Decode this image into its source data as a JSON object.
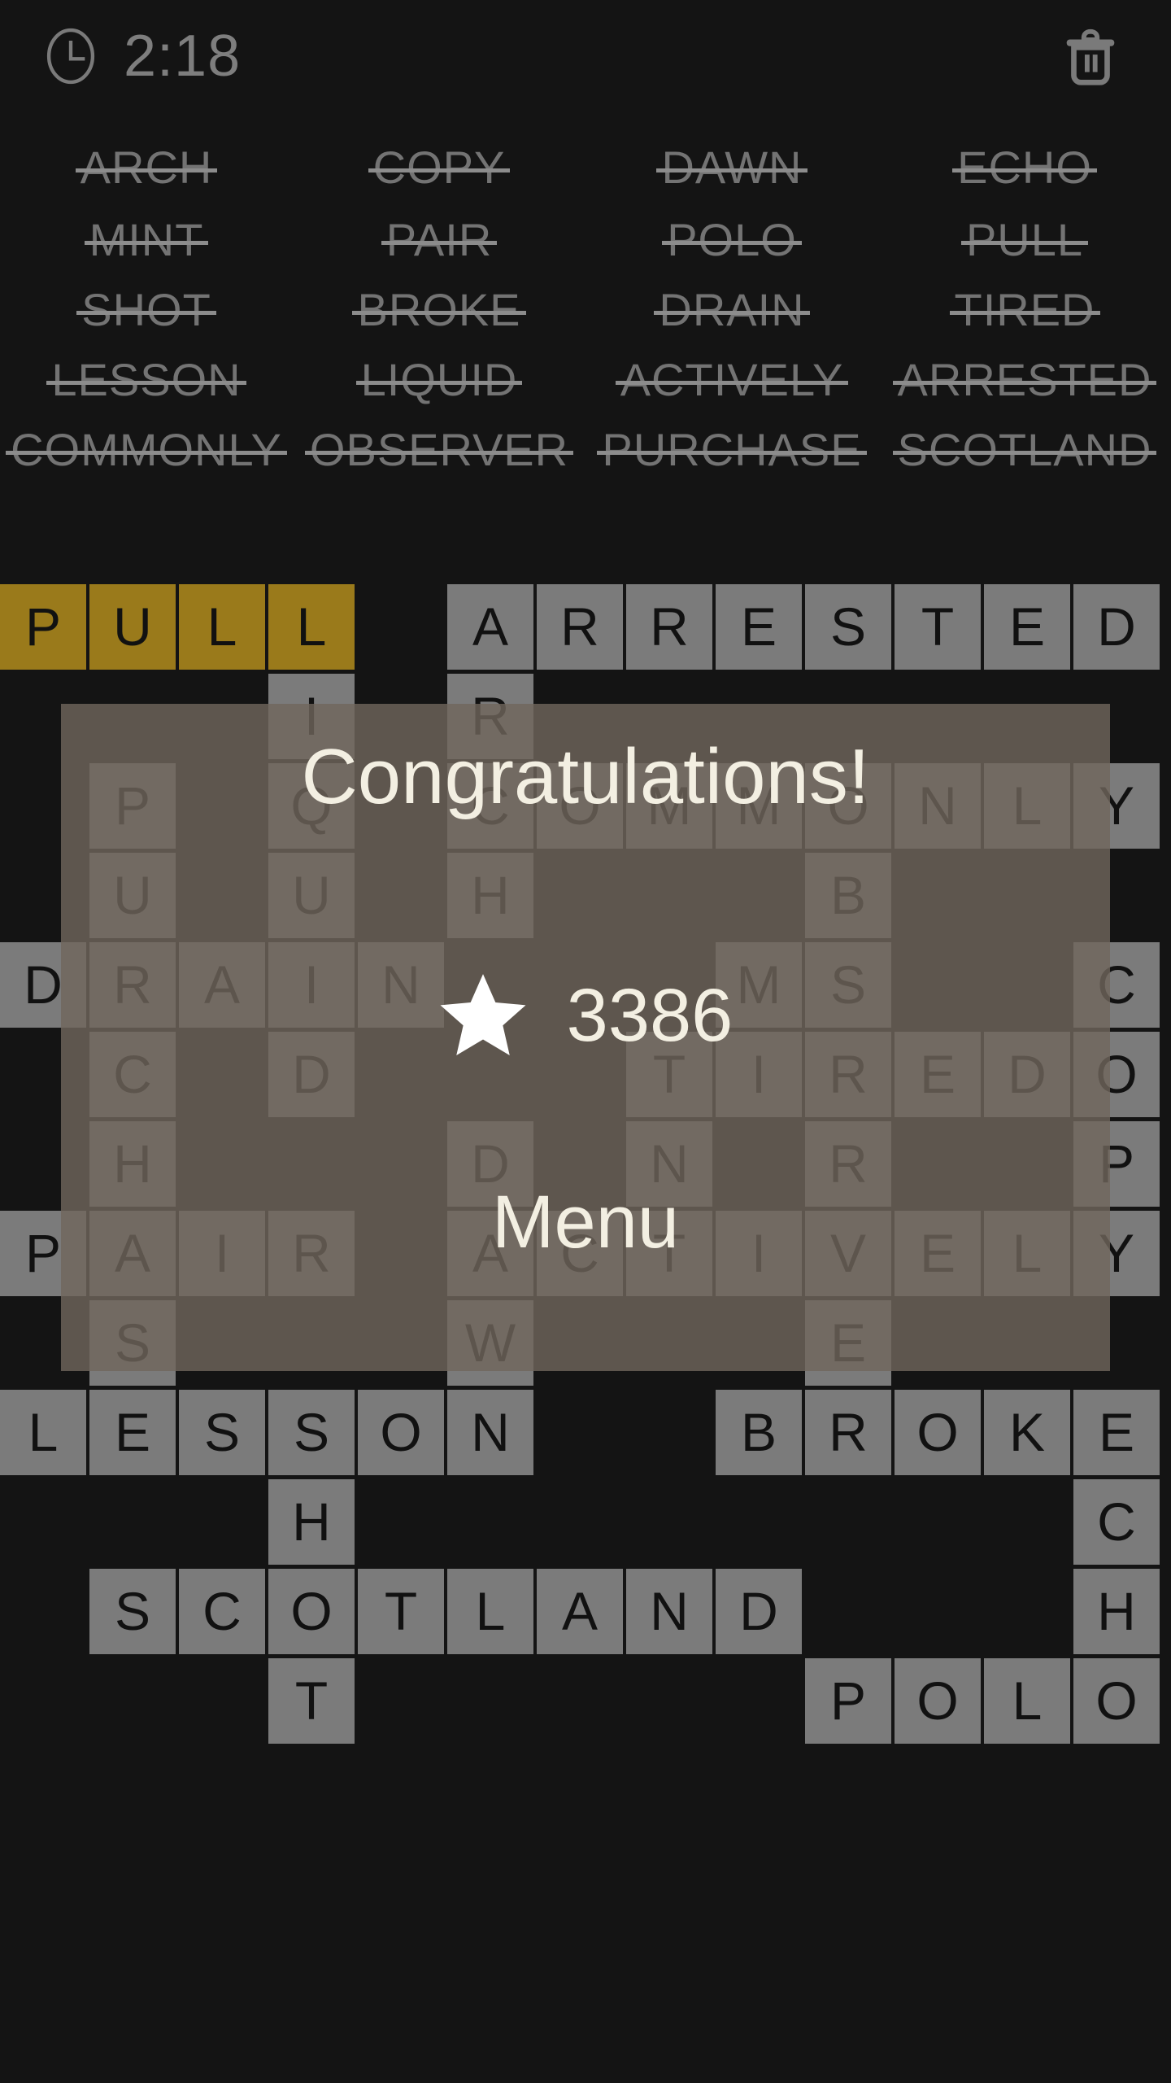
{
  "app": {
    "title": "Word Crossword Game",
    "background_color": "#141414"
  },
  "topbar": {
    "clock_icon": "clock-icon",
    "timer": "2:18",
    "trash_icon": "trash-icon"
  },
  "word_list": {
    "columns": 4,
    "rows": [
      [
        "ARCH",
        "COPY",
        "DAWN",
        "ECHO"
      ],
      [
        "MINT",
        "PAIR",
        "POLO",
        "PULL"
      ],
      [
        "SHOT",
        "BROKE",
        "DRAIN",
        "TIRED"
      ],
      [
        "LESSON",
        "LIQUID",
        "ACTIVELY",
        "ARRESTED"
      ],
      [
        "COMMONLY",
        "OBSERVER",
        "PURCHASE",
        "SCOTLAND"
      ]
    ],
    "all_struck_through": true
  },
  "grid": {
    "columns": 13,
    "rows": 13,
    "cell_size": 110,
    "colors": {
      "tile": "#7b7b7b",
      "tile_highlight": "#9a7a1b",
      "letter": "#111111"
    },
    "cells": [
      {
        "r": 0,
        "c": 0,
        "l": "P",
        "h": true
      },
      {
        "r": 0,
        "c": 1,
        "l": "U",
        "h": true
      },
      {
        "r": 0,
        "c": 2,
        "l": "L",
        "h": true
      },
      {
        "r": 0,
        "c": 3,
        "l": "L",
        "h": true
      },
      {
        "r": 0,
        "c": 5,
        "l": "A"
      },
      {
        "r": 0,
        "c": 6,
        "l": "R"
      },
      {
        "r": 0,
        "c": 7,
        "l": "R"
      },
      {
        "r": 0,
        "c": 8,
        "l": "E"
      },
      {
        "r": 0,
        "c": 9,
        "l": "S"
      },
      {
        "r": 0,
        "c": 10,
        "l": "T"
      },
      {
        "r": 0,
        "c": 11,
        "l": "E"
      },
      {
        "r": 0,
        "c": 12,
        "l": "D"
      },
      {
        "r": 1,
        "c": 3,
        "l": "I"
      },
      {
        "r": 1,
        "c": 5,
        "l": "R"
      },
      {
        "r": 2,
        "c": 1,
        "l": "P"
      },
      {
        "r": 2,
        "c": 3,
        "l": "Q"
      },
      {
        "r": 2,
        "c": 5,
        "l": "C"
      },
      {
        "r": 2,
        "c": 6,
        "l": "O"
      },
      {
        "r": 2,
        "c": 7,
        "l": "M"
      },
      {
        "r": 2,
        "c": 8,
        "l": "M"
      },
      {
        "r": 2,
        "c": 9,
        "l": "O"
      },
      {
        "r": 2,
        "c": 10,
        "l": "N"
      },
      {
        "r": 2,
        "c": 11,
        "l": "L"
      },
      {
        "r": 2,
        "c": 12,
        "l": "Y"
      },
      {
        "r": 3,
        "c": 1,
        "l": "U"
      },
      {
        "r": 3,
        "c": 3,
        "l": "U"
      },
      {
        "r": 3,
        "c": 5,
        "l": "H"
      },
      {
        "r": 3,
        "c": 9,
        "l": "B"
      },
      {
        "r": 4,
        "c": 0,
        "l": "D"
      },
      {
        "r": 4,
        "c": 1,
        "l": "R"
      },
      {
        "r": 4,
        "c": 2,
        "l": "A"
      },
      {
        "r": 4,
        "c": 3,
        "l": "I"
      },
      {
        "r": 4,
        "c": 4,
        "l": "N"
      },
      {
        "r": 4,
        "c": 8,
        "l": "M"
      },
      {
        "r": 4,
        "c": 9,
        "l": "S"
      },
      {
        "r": 4,
        "c": 12,
        "l": "C"
      },
      {
        "r": 5,
        "c": 1,
        "l": "C"
      },
      {
        "r": 5,
        "c": 3,
        "l": "D"
      },
      {
        "r": 5,
        "c": 7,
        "l": "T"
      },
      {
        "r": 5,
        "c": 8,
        "l": "I"
      },
      {
        "r": 5,
        "c": 9,
        "l": "R"
      },
      {
        "r": 5,
        "c": 10,
        "l": "E"
      },
      {
        "r": 5,
        "c": 11,
        "l": "D"
      },
      {
        "r": 5,
        "c": 12,
        "l": "O"
      },
      {
        "r": 6,
        "c": 1,
        "l": "H"
      },
      {
        "r": 6,
        "c": 5,
        "l": "D"
      },
      {
        "r": 6,
        "c": 7,
        "l": "N"
      },
      {
        "r": 6,
        "c": 9,
        "l": "R"
      },
      {
        "r": 6,
        "c": 12,
        "l": "P"
      },
      {
        "r": 7,
        "c": 0,
        "l": "P"
      },
      {
        "r": 7,
        "c": 1,
        "l": "A"
      },
      {
        "r": 7,
        "c": 2,
        "l": "I"
      },
      {
        "r": 7,
        "c": 3,
        "l": "R"
      },
      {
        "r": 7,
        "c": 5,
        "l": "A"
      },
      {
        "r": 7,
        "c": 6,
        "l": "C"
      },
      {
        "r": 7,
        "c": 7,
        "l": "T"
      },
      {
        "r": 7,
        "c": 8,
        "l": "I"
      },
      {
        "r": 7,
        "c": 9,
        "l": "V"
      },
      {
        "r": 7,
        "c": 10,
        "l": "E"
      },
      {
        "r": 7,
        "c": 11,
        "l": "L"
      },
      {
        "r": 7,
        "c": 12,
        "l": "Y"
      },
      {
        "r": 8,
        "c": 1,
        "l": "S"
      },
      {
        "r": 8,
        "c": 5,
        "l": "W"
      },
      {
        "r": 8,
        "c": 9,
        "l": "E"
      },
      {
        "r": 9,
        "c": 0,
        "l": "L"
      },
      {
        "r": 9,
        "c": 1,
        "l": "E"
      },
      {
        "r": 9,
        "c": 2,
        "l": "S"
      },
      {
        "r": 9,
        "c": 3,
        "l": "S"
      },
      {
        "r": 9,
        "c": 4,
        "l": "O"
      },
      {
        "r": 9,
        "c": 5,
        "l": "N"
      },
      {
        "r": 9,
        "c": 8,
        "l": "B"
      },
      {
        "r": 9,
        "c": 9,
        "l": "R"
      },
      {
        "r": 9,
        "c": 10,
        "l": "O"
      },
      {
        "r": 9,
        "c": 11,
        "l": "K"
      },
      {
        "r": 9,
        "c": 12,
        "l": "E"
      },
      {
        "r": 10,
        "c": 3,
        "l": "H"
      },
      {
        "r": 10,
        "c": 12,
        "l": "C"
      },
      {
        "r": 11,
        "c": 1,
        "l": "S"
      },
      {
        "r": 11,
        "c": 2,
        "l": "C"
      },
      {
        "r": 11,
        "c": 3,
        "l": "O"
      },
      {
        "r": 11,
        "c": 4,
        "l": "T"
      },
      {
        "r": 11,
        "c": 5,
        "l": "L"
      },
      {
        "r": 11,
        "c": 6,
        "l": "A"
      },
      {
        "r": 11,
        "c": 7,
        "l": "N"
      },
      {
        "r": 11,
        "c": 8,
        "l": "D"
      },
      {
        "r": 11,
        "c": 12,
        "l": "H"
      },
      {
        "r": 12,
        "c": 3,
        "l": "T"
      },
      {
        "r": 12,
        "c": 9,
        "l": "P"
      },
      {
        "r": 12,
        "c": 10,
        "l": "O"
      },
      {
        "r": 12,
        "c": 11,
        "l": "L"
      },
      {
        "r": 12,
        "c": 12,
        "l": "O"
      }
    ]
  },
  "overlay": {
    "congrats_label": "Congratulations!",
    "star_icon": "star-icon",
    "score": "3386",
    "menu_label": "Menu",
    "panel_color": "rgba(112,103,92,0.80)",
    "text_color": "#f3efe2"
  }
}
